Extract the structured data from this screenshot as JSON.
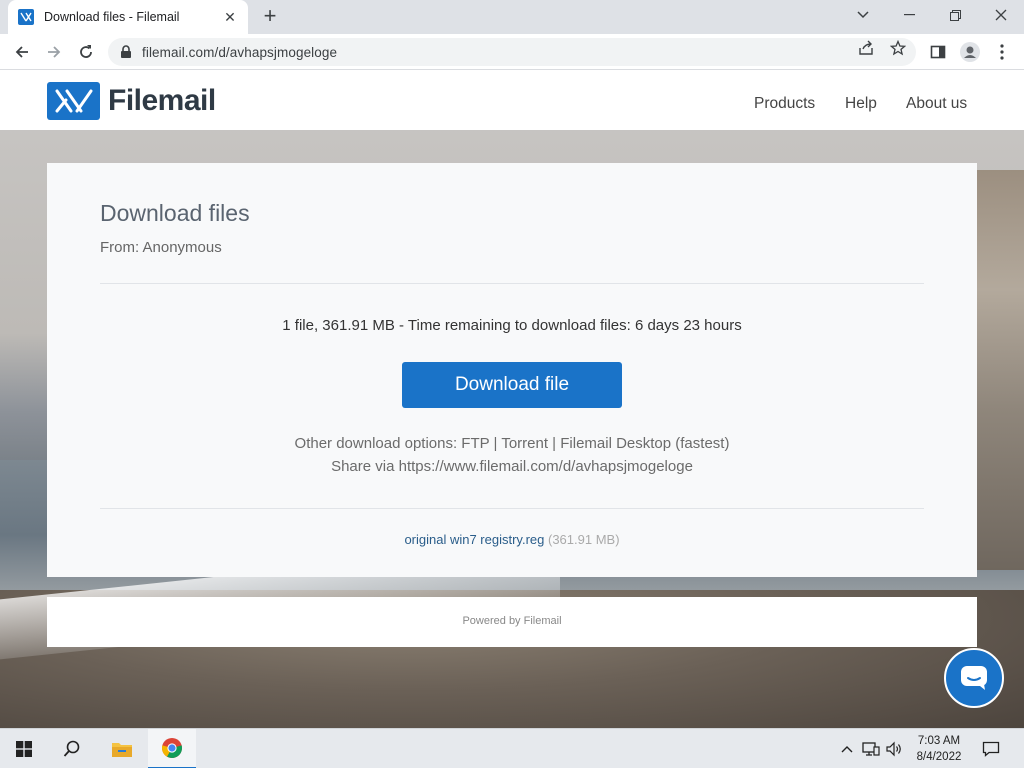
{
  "browser": {
    "tab_title": "Download files - Filemail",
    "url": "filemail.com/d/avhapsjmogeloge"
  },
  "site": {
    "logo_text": "Filemail",
    "nav": [
      "Products",
      "Help",
      "About us"
    ]
  },
  "download": {
    "title": "Download files",
    "from": "From: Anonymous",
    "summary": "1 file, 361.91 MB - Time remaining to download files: 6 days 23 hours",
    "button_label": "Download file",
    "other_options": "Other download options: FTP  |  Torrent  |  Filemail Desktop (fastest)",
    "share": "Share via https://www.filemail.com/d/avhapsjmogeloge",
    "file_name": "original win7 registry.reg",
    "file_size": "(361.91 MB)"
  },
  "footer": {
    "powered_by": "Powered by Filemail"
  },
  "taskbar": {
    "time": "7:03 AM",
    "date": "8/4/2022"
  },
  "colors": {
    "brand_blue": "#1a73c8",
    "card_bg": "#f8f9fa"
  },
  "icons": [
    "filemail-favicon",
    "close-icon",
    "plus-icon",
    "back-icon",
    "forward-icon",
    "reload-icon",
    "lock-icon",
    "share-icon",
    "star-icon",
    "sidepanel-icon",
    "profile-icon",
    "menu-icon",
    "chat-icon",
    "windows-start-icon",
    "search-icon",
    "file-explorer-icon",
    "chrome-icon",
    "network-icon",
    "volume-icon",
    "notification-icon"
  ]
}
